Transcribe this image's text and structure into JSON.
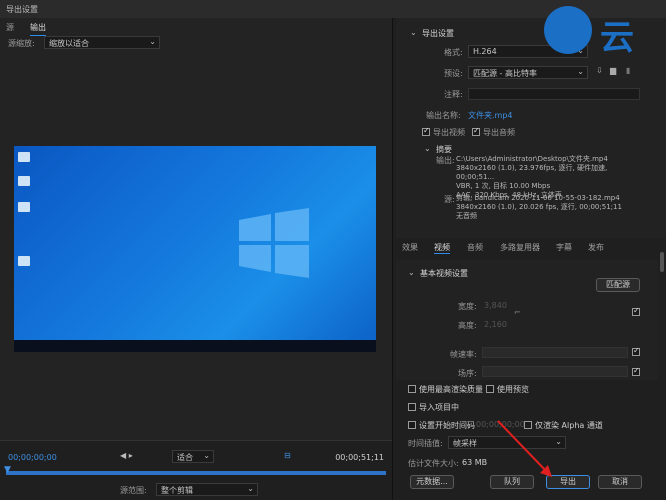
{
  "window": {
    "title": "导出设置"
  },
  "left_tabs": [
    {
      "label": "源"
    },
    {
      "label": "输出"
    }
  ],
  "source_scaling": {
    "label": "源缩放:",
    "value": "缩放以适合"
  },
  "timeline": {
    "start_tc": "00;00;00;00",
    "end_tc": "00;00;51;11",
    "fit": "适合",
    "source_range_label": "源范围:",
    "source_range_value": "整个剪辑"
  },
  "export_settings": {
    "section_title": "导出设置",
    "format_label": "格式:",
    "format_value": "H.264",
    "preset_label": "预设:",
    "preset_value": "匹配源 - 高比特率",
    "comments_label": "注释:",
    "output_name_label": "输出名称:",
    "output_name_value": "文件夹.mp4",
    "export_video": "导出视频",
    "export_audio": "导出音频",
    "summary_title": "摘要",
    "output_label": "输出:",
    "output_lines": [
      "C:\\Users\\Administrator\\Desktop\\文件夹.mp4",
      "3840x2160 (1.0), 23.976fps, 逐行, 硬件加速, 00;00;51...",
      "VBR, 1 次, 目标 10.00 Mbps",
      "AAC, 320 Kbps, 48 kHz, 立体声"
    ],
    "source_label": "源:",
    "source_lines": [
      "剪辑, bandicam 2020-11-06 10-55-03-182.mp4",
      "3840x2160 (1.0), 20.026 fps, 逐行, 00;00;51;11",
      "无音频"
    ]
  },
  "right_tabs": [
    {
      "label": "效果"
    },
    {
      "label": "视频"
    },
    {
      "label": "音频"
    },
    {
      "label": "多路复用器"
    },
    {
      "label": "字幕"
    },
    {
      "label": "发布"
    }
  ],
  "basic_video": {
    "title": "基本视频设置",
    "match_source": "匹配源",
    "width_label": "宽度:",
    "width_value": "3,840",
    "height_label": "高度:",
    "height_value": "2,160",
    "frame_rate_label": "帧速率:",
    "field_order_label": "场序:"
  },
  "bottom": {
    "max_render_quality": "使用最高渲染质量",
    "use_previews": "使用预览",
    "import_into_project": "导入项目中",
    "set_start_timecode": "设置开始时间码",
    "start_timecode": "00;00;00;00",
    "alpha_only": "仅渲染 Alpha 通道",
    "time_interp_label": "时间插值:",
    "time_interp_value": "帧采样",
    "est_size_label": "估计文件大小:",
    "est_size_value": "63 MB",
    "metadata_btn": "元数据...",
    "queue_btn": "队列",
    "export_btn": "导出",
    "cancel_btn": "取消"
  },
  "logo": {
    "text": "云"
  }
}
